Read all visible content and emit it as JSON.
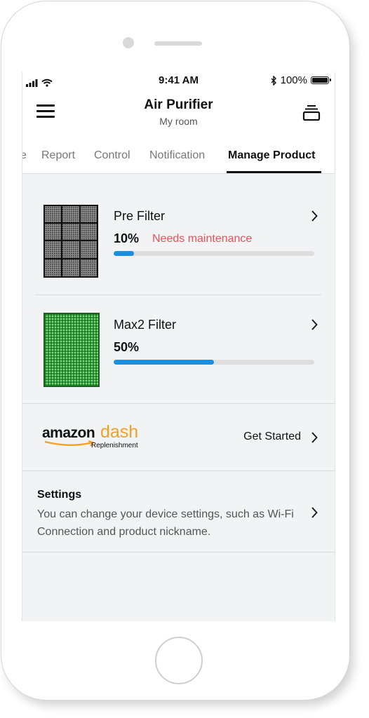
{
  "status_bar": {
    "time": "9:41 AM",
    "battery": "100%"
  },
  "header": {
    "title": "Air Purifier",
    "subtitle": "My room"
  },
  "tabs": [
    {
      "label": "e"
    },
    {
      "label": "Report"
    },
    {
      "label": "Control"
    },
    {
      "label": "Notification"
    },
    {
      "label": "Manage Product",
      "active": true
    }
  ],
  "filters": [
    {
      "name": "Pre Filter",
      "percent_text": "10%",
      "percent": 0.1,
      "status": "Needs maintenance",
      "status_color": "#e8505b",
      "icon": "pre-filter-grid-icon"
    },
    {
      "name": "Max2 Filter",
      "percent_text": "50%",
      "percent": 0.5,
      "status": "",
      "icon": "max2-filter-green-icon"
    }
  ],
  "amazon": {
    "logo_word": "amazon",
    "dash_word": "dash",
    "tagline": "Replenishment",
    "action": "Get Started"
  },
  "settings": {
    "title": "Settings",
    "description": "You can change your device settings, such as Wi-Fi Connection and product nickname."
  },
  "colors": {
    "progress": "#1a8fe0",
    "track": "#dedede",
    "warning": "#e8505b",
    "amazon_orange": "#f3a023"
  }
}
